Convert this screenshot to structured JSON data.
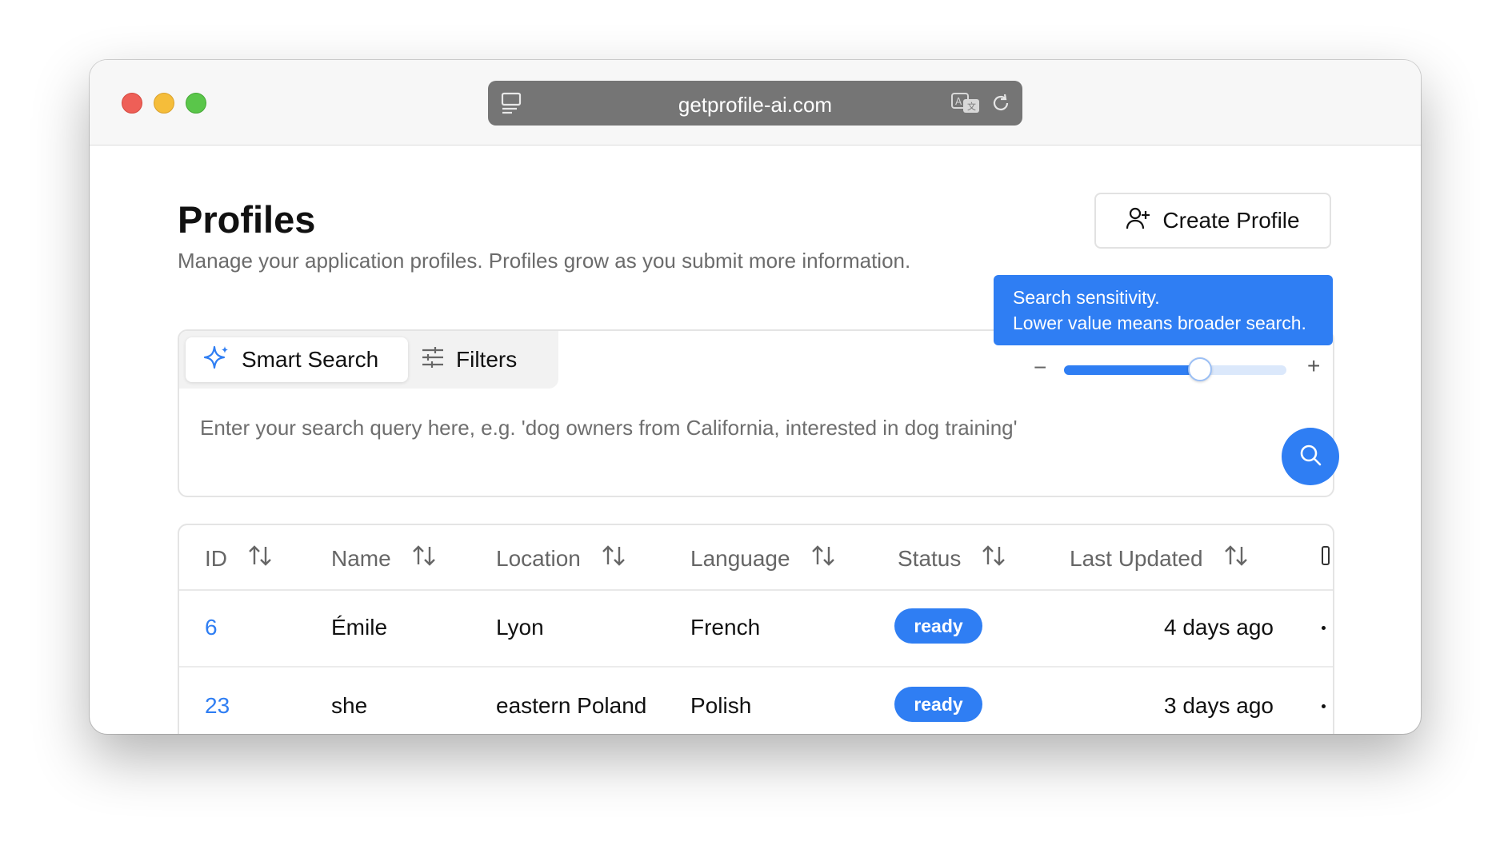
{
  "browser": {
    "url": "getprofile-ai.com"
  },
  "header": {
    "title": "Profiles",
    "subtitle": "Manage your application profiles. Profiles grow as you submit more information.",
    "create_button": "Create Profile"
  },
  "tooltip": {
    "line1": "Search sensitivity.",
    "line2": "Lower value means broader search."
  },
  "search": {
    "tabs": [
      {
        "label": "Smart Search",
        "active": true,
        "icon": "sparkle-icon"
      },
      {
        "label": "Filters",
        "active": false,
        "icon": "sliders-icon"
      }
    ],
    "placeholder": "Enter your search query here, e.g. 'dog owners from California, interested in dog training'",
    "sensitivity": 0.61,
    "minus": "−",
    "plus": "+"
  },
  "table": {
    "columns": [
      "ID",
      "Name",
      "Location",
      "Language",
      "Status",
      "Last Updated"
    ],
    "rows": [
      {
        "id": "6",
        "name": "Émile",
        "location": "Lyon",
        "language": "French",
        "status": "ready",
        "updated": "4 days ago"
      },
      {
        "id": "23",
        "name": "she",
        "location": "eastern Poland",
        "language": "Polish",
        "status": "ready",
        "updated": "3 days ago"
      }
    ]
  },
  "colors": {
    "accent": "#2f7ef3",
    "tooltip_bg": "#2f7ef3"
  }
}
